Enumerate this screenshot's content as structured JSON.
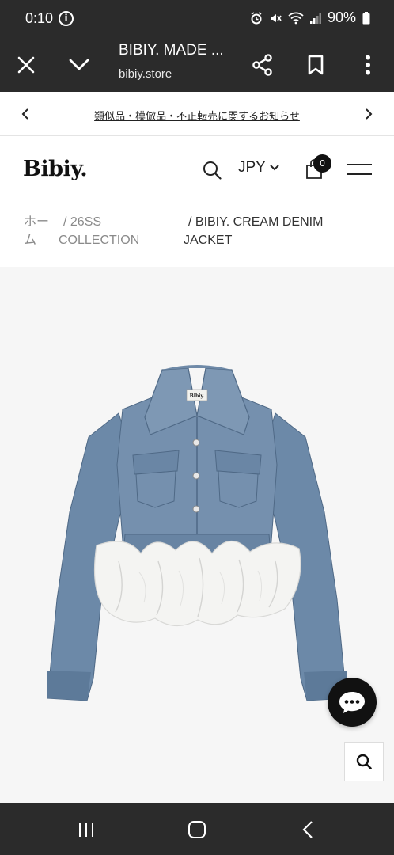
{
  "status": {
    "time": "0:10",
    "battery": "90%",
    "icons": [
      "info-icon",
      "alarm-icon",
      "mute-icon",
      "wifi-icon",
      "signal-icon",
      "battery-icon"
    ]
  },
  "browser": {
    "title": "BIBIY. MADE ...",
    "url": "bibiy.store",
    "icons": [
      "close-icon",
      "chevron-down-icon",
      "share-icon",
      "bookmark-icon",
      "more-vert-icon"
    ]
  },
  "announcement": {
    "text": "類似品・模倣品・不正転売に関するお知らせ"
  },
  "header": {
    "logo": "Bibiy.",
    "currency": "JPY",
    "cart_count": "0"
  },
  "breadcrumb": {
    "home_line1": "ホー",
    "home_line2": "ム",
    "collection_line1": "/ 26SS",
    "collection_line2": "COLLECTION",
    "current_line1": "/ BIBIY. CREAM DENIM",
    "current_line2": "JACKET"
  },
  "product": {
    "image_alt": "BIBIY. CREAM DENIM JACKET",
    "label_text": "Bibiy.",
    "colors": {
      "denim": "#6e8aa8",
      "denim_dark": "#4f6986",
      "ruffle": "#f4f4f2",
      "background": "#f6f6f6"
    }
  },
  "colors": {
    "system_bar": "#2b2b2b",
    "accent": "#111111"
  }
}
